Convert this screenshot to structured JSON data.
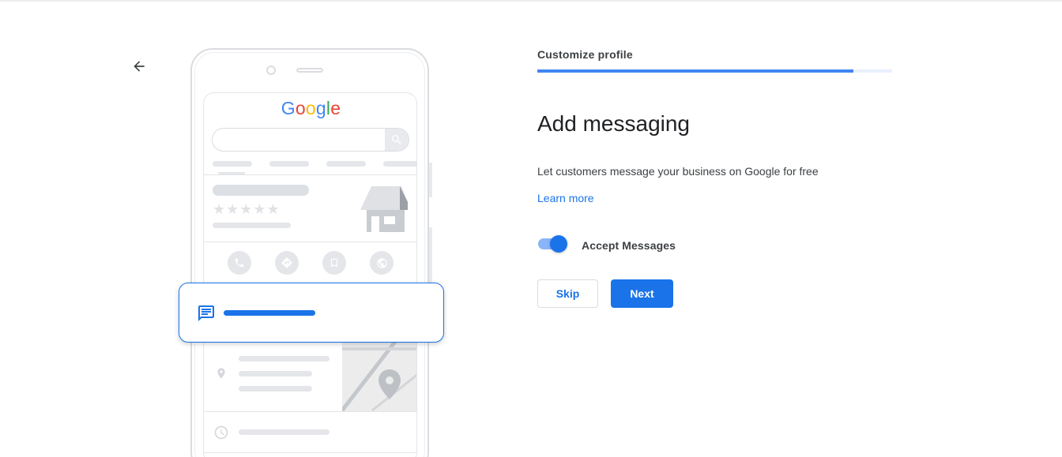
{
  "header": {
    "back_icon": "arrow-back-icon"
  },
  "illustration": {
    "logo_letters": [
      {
        "char": "G",
        "color": "#4285f4"
      },
      {
        "char": "o",
        "color": "#ea4335"
      },
      {
        "char": "o",
        "color": "#fbbc05"
      },
      {
        "char": "g",
        "color": "#4285f4"
      },
      {
        "char": "l",
        "color": "#34a853"
      },
      {
        "char": "e",
        "color": "#ea4335"
      }
    ],
    "rating_stars": "★★★★★",
    "action_icons": [
      "phone-icon",
      "directions-icon",
      "bookmark-icon",
      "website-globe-icon"
    ],
    "message_icon": "chat-message-icon",
    "accent_color": "#1a73e8"
  },
  "step": {
    "title": "Customize profile",
    "progress": 0.89
  },
  "content": {
    "heading": "Add messaging",
    "description": "Let customers message your business on Google for free",
    "learn_more": "Learn more",
    "toggle_label": "Accept Messages",
    "toggle_on": true
  },
  "buttons": {
    "skip": "Skip",
    "next": "Next"
  },
  "colors": {
    "primary": "#1a73e8",
    "progress_fill": "#4285f4",
    "progress_track": "#e8f0fe"
  }
}
